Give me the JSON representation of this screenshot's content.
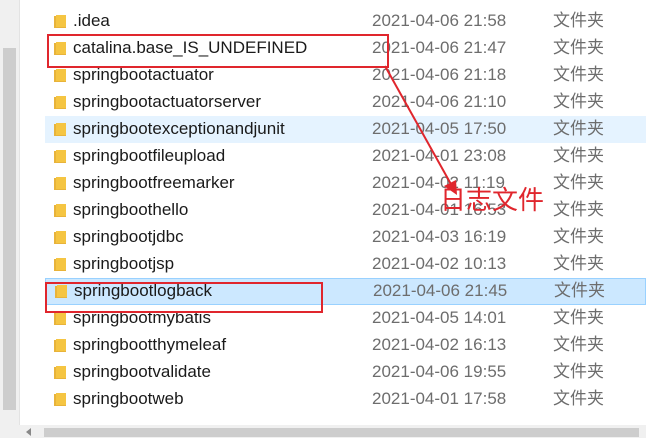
{
  "rows": [
    {
      "name": ".idea",
      "date": "2021-04-06 21:58",
      "type": "文件夹"
    },
    {
      "name": "catalina.base_IS_UNDEFINED",
      "date": "2021-04-06 21:47",
      "type": "文件夹"
    },
    {
      "name": "springbootactuator",
      "date": "2021-04-06 21:18",
      "type": "文件夹"
    },
    {
      "name": "springbootactuatorserver",
      "date": "2021-04-06 21:10",
      "type": "文件夹"
    },
    {
      "name": "springbootexceptionandjunit",
      "date": "2021-04-05 17:50",
      "type": "文件夹"
    },
    {
      "name": "springbootfileupload",
      "date": "2021-04-01 23:08",
      "type": "文件夹"
    },
    {
      "name": "springbootfreemarker",
      "date": "2021-04-02 11:19",
      "type": "文件夹"
    },
    {
      "name": "springboothello",
      "date": "2021-04-01 16:53",
      "type": "文件夹"
    },
    {
      "name": "springbootjdbc",
      "date": "2021-04-03 16:19",
      "type": "文件夹"
    },
    {
      "name": "springbootjsp",
      "date": "2021-04-02 10:13",
      "type": "文件夹"
    },
    {
      "name": "springbootlogback",
      "date": "2021-04-06 21:45",
      "type": "文件夹"
    },
    {
      "name": "springbootmybatis",
      "date": "2021-04-05 14:01",
      "type": "文件夹"
    },
    {
      "name": "springbootthymeleaf",
      "date": "2021-04-02 16:13",
      "type": "文件夹"
    },
    {
      "name": "springbootvalidate",
      "date": "2021-04-06 19:55",
      "type": "文件夹"
    },
    {
      "name": "springbootweb",
      "date": "2021-04-01 17:58",
      "type": "文件夹"
    }
  ],
  "annotation": {
    "label": "日志文件"
  },
  "colors": {
    "annotation": "#e0262d",
    "selected": "#cce8ff",
    "hover": "#e5f3ff",
    "folder": "#f5c542"
  }
}
